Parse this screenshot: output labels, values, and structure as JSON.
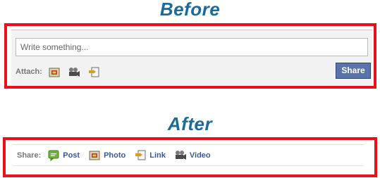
{
  "before": {
    "title": "Before",
    "composer": {
      "placeholder": "Write something...",
      "attach_label": "Attach:",
      "attach_icons": [
        "photo-icon",
        "video-icon",
        "link-icon"
      ],
      "share_button": "Share"
    }
  },
  "after": {
    "title": "After",
    "share_bar": {
      "label": "Share:",
      "items": [
        {
          "label": "Post",
          "icon": "post-icon"
        },
        {
          "label": "Photo",
          "icon": "photo-icon"
        },
        {
          "label": "Link",
          "icon": "link-icon"
        },
        {
          "label": "Video",
          "icon": "video-icon"
        }
      ]
    }
  },
  "colors": {
    "title": "#1a6a9a",
    "frame": "#e8101c",
    "button": "#5b74a8",
    "link": "#3b5998"
  }
}
